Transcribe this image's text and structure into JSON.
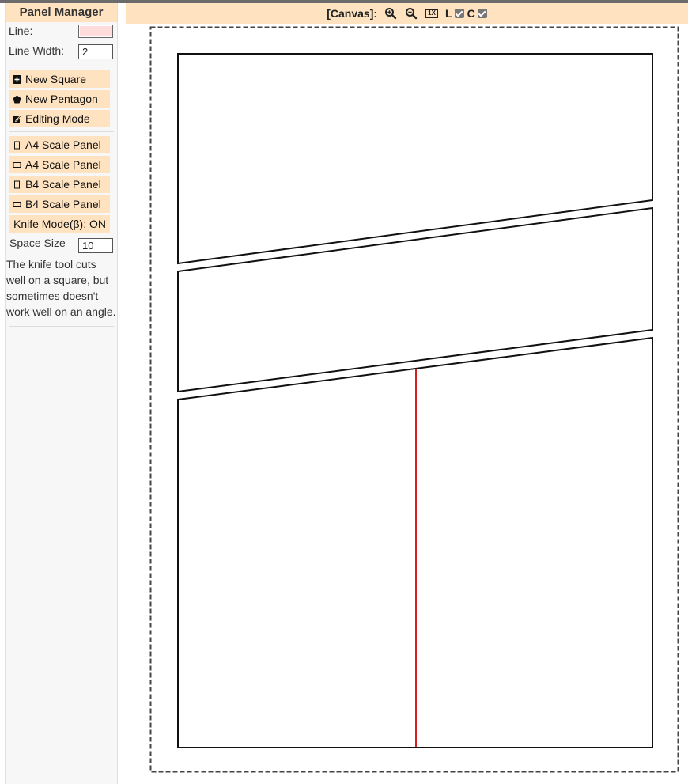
{
  "sidebar": {
    "title": "Panel Manager",
    "line_label": "Line:",
    "line_color": "#ffdcdc",
    "line_width_label": "Line Width:",
    "line_width_value": "2",
    "buttons": {
      "new_square": "New Square",
      "new_pentagon": "New Pentagon",
      "editing_mode": "Editing Mode",
      "a4_portrait": "A4 Scale Panel",
      "a4_landscape": "A4 Scale Panel",
      "b4_portrait": "B4 Scale Panel",
      "b4_landscape": "B4 Scale Panel",
      "knife_mode": "Knife Mode(β): ON"
    },
    "space_size_label": "Space Size",
    "space_size_value": "10",
    "help_text": "The knife tool cuts well on a square, but sometimes doesn't work well on an angle."
  },
  "canvas_header": {
    "label": "[Canvas]:",
    "zoom_in_icon": "zoom-in-icon",
    "zoom_out_icon": "zoom-out-icon",
    "reset_zoom_label": "1X",
    "layer_label": "L",
    "layer_checked": true,
    "c_label": "C",
    "c_checked": true
  },
  "colors": {
    "accent": "#ffe3c0",
    "sidebar_bg": "#f7f7f7",
    "panel_stroke": "#111111",
    "knife_line": "#d42020",
    "canvas_border": "#444444"
  }
}
